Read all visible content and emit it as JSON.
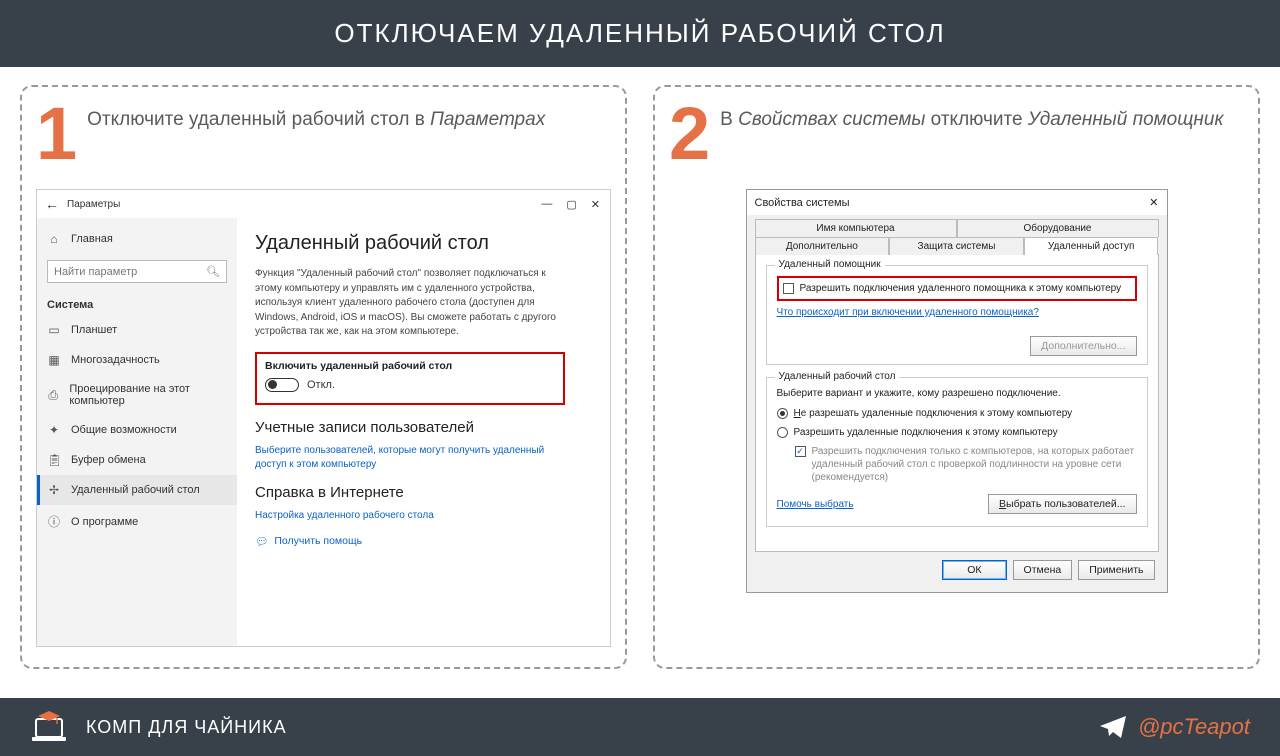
{
  "header": {
    "title": "ОТКЛЮЧАЕМ УДАЛЕННЫЙ РАБОЧИЙ СТОЛ"
  },
  "panels": {
    "one": {
      "num": "1",
      "title_pre": "Отключите удаленный рабочий стол в ",
      "title_em": "Параметрах"
    },
    "two": {
      "num": "2",
      "title_pre": "В ",
      "title_em1": "Свойствах системы",
      "title_mid": " отключите ",
      "title_em2": "Удаленный помощник"
    }
  },
  "settings": {
    "window_title": "Параметры",
    "home": "Главная",
    "search_placeholder": "Найти параметр",
    "section": "Система",
    "items": {
      "tablet": "Планшет",
      "multitask": "Многозадачность",
      "projection": "Проецирование на этот компьютер",
      "shared": "Общие возможности",
      "clipboard": "Буфер обмена",
      "rdp": "Удаленный рабочий стол",
      "about": "О программе"
    },
    "main": {
      "h1": "Удаленный рабочий стол",
      "desc": "Функция \"Удаленный рабочий стол\" позволяет подключаться к этому компьютеру и управлять им с удаленного устройства, используя клиент удаленного рабочего стола (доступен для Windows, Android, iOS и macOS). Вы сможете работать с другого устройства так же, как на этом компьютере.",
      "toggle_label": "Включить удаленный рабочий стол",
      "toggle_state": "Откл.",
      "h2_users": "Учетные записи пользователей",
      "link_users": "Выберите пользователей, которые могут получить удаленный доступ к этом компьютеру",
      "h2_help": "Справка в Интернете",
      "link_help": "Настройка удаленного рабочего стола",
      "get_help": "Получить помощь"
    }
  },
  "sysprops": {
    "title": "Свойства системы",
    "tabs": {
      "name": "Имя компьютера",
      "hw": "Оборудование",
      "adv": "Дополнительно",
      "protect": "Защита системы",
      "remote": "Удаленный доступ"
    },
    "assist": {
      "legend": "Удаленный помощник",
      "checkbox": "Разрешить подключения удаленного помощника к этому компьютеру",
      "link": "Что происходит при включении удаленного помощника?",
      "advanced_btn": "Дополнительно..."
    },
    "rdp": {
      "legend": "Удаленный рабочий стол",
      "desc": "Выберите вариант и укажите, кому разрешено подключение.",
      "opt_deny_pre": "Н",
      "opt_deny_post": "е разрешать удаленные подключения к этому компьютеру",
      "opt_allow_pre": "Ра",
      "opt_allow_post": "зрешить удаленные подключения к этому компьютеру",
      "nla": "Разрешить подключения только с компьютеров, на которых работает удаленный рабочий стол с проверкой подлинности на уровне сети (рекомендуется)",
      "help_link": "Помочь выбрать",
      "select_users_pre": "В",
      "select_users_post": "ыбрать пользователей..."
    },
    "buttons": {
      "ok": "ОК",
      "cancel": "Отмена",
      "apply": "Применить"
    }
  },
  "footer": {
    "brand": "КОМП ДЛЯ ЧАЙНИКА",
    "handle": "@pcTeapot"
  }
}
